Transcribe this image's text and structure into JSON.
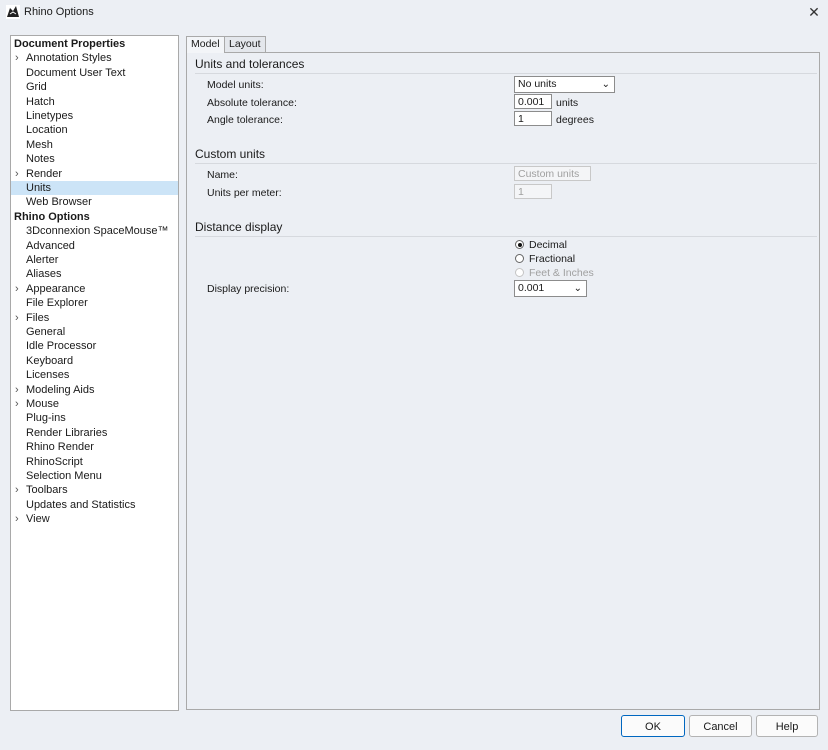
{
  "window": {
    "title": "Rhino Options",
    "close_icon": "close-icon"
  },
  "tree": {
    "items": [
      {
        "label": "Document Properties",
        "header": true
      },
      {
        "label": "Annotation Styles",
        "expander": true
      },
      {
        "label": "Document User Text"
      },
      {
        "label": "Grid"
      },
      {
        "label": "Hatch"
      },
      {
        "label": "Linetypes"
      },
      {
        "label": "Location"
      },
      {
        "label": "Mesh"
      },
      {
        "label": "Notes"
      },
      {
        "label": "Render",
        "expander": true
      },
      {
        "label": "Units",
        "selected": true
      },
      {
        "label": "Web Browser"
      },
      {
        "label": "Rhino Options",
        "header": true
      },
      {
        "label": "3Dconnexion SpaceMouse™"
      },
      {
        "label": "Advanced"
      },
      {
        "label": "Alerter"
      },
      {
        "label": "Aliases"
      },
      {
        "label": "Appearance",
        "expander": true
      },
      {
        "label": "File Explorer"
      },
      {
        "label": "Files",
        "expander": true
      },
      {
        "label": "General"
      },
      {
        "label": "Idle Processor"
      },
      {
        "label": "Keyboard"
      },
      {
        "label": "Licenses"
      },
      {
        "label": "Modeling Aids",
        "expander": true
      },
      {
        "label": "Mouse",
        "expander": true
      },
      {
        "label": "Plug-ins"
      },
      {
        "label": "Render Libraries"
      },
      {
        "label": "Rhino Render"
      },
      {
        "label": "RhinoScript"
      },
      {
        "label": "Selection Menu"
      },
      {
        "label": "Toolbars",
        "expander": true
      },
      {
        "label": "Updates and Statistics"
      },
      {
        "label": "View",
        "expander": true
      }
    ]
  },
  "tabs": [
    {
      "label": "Model",
      "active": true
    },
    {
      "label": "Layout",
      "active": false
    }
  ],
  "units_tolerances": {
    "title": "Units and tolerances",
    "model_units_label": "Model units:",
    "model_units_value": "No units",
    "abs_tol_label": "Absolute tolerance:",
    "abs_tol_value": "0.001",
    "abs_tol_unit": "units",
    "angle_tol_label": "Angle tolerance:",
    "angle_tol_value": "1",
    "angle_tol_unit": "degrees"
  },
  "custom_units": {
    "title": "Custom units",
    "name_label": "Name:",
    "name_placeholder": "Custom units",
    "upm_label": "Units per meter:",
    "upm_value": "1"
  },
  "distance_display": {
    "title": "Distance display",
    "options": [
      {
        "label": "Decimal",
        "checked": true,
        "disabled": false
      },
      {
        "label": "Fractional",
        "checked": false,
        "disabled": false
      },
      {
        "label": "Feet & Inches",
        "checked": false,
        "disabled": true
      }
    ],
    "precision_label": "Display precision:",
    "precision_value": "0.001"
  },
  "buttons": {
    "ok": "OK",
    "cancel": "Cancel",
    "help": "Help"
  },
  "colors": {
    "selection": "#cce4f7",
    "primary_border": "#0067c0"
  }
}
